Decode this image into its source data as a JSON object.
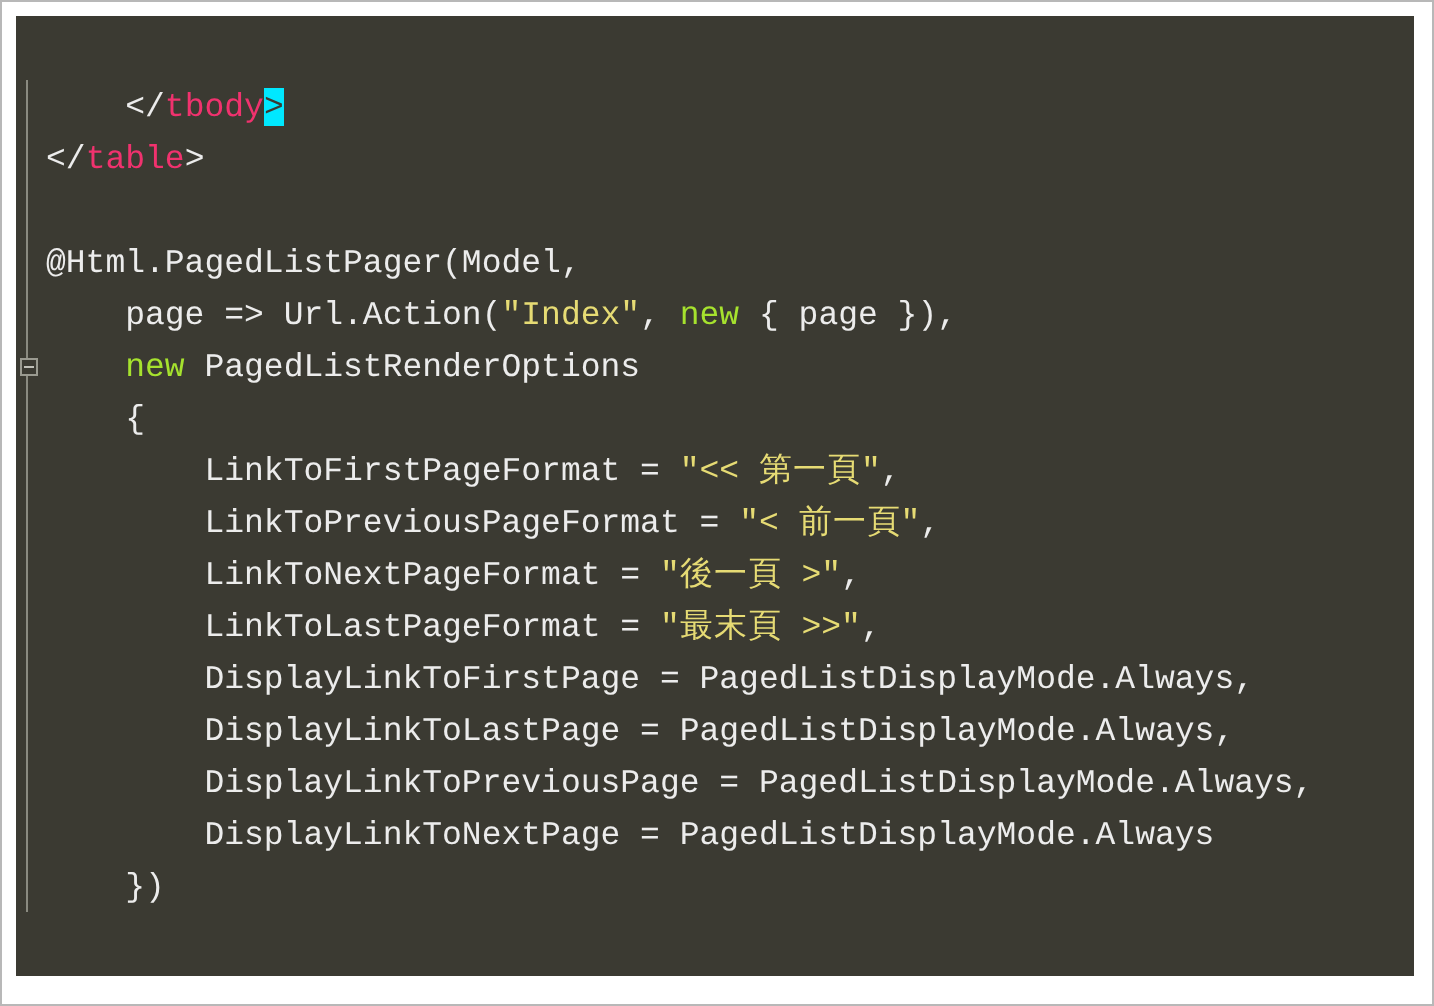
{
  "editor": {
    "lines": [
      {
        "kind": "code",
        "foldable": false,
        "tokens": [
          {
            "kind": "plain",
            "text": "    </"
          },
          {
            "kind": "tag",
            "text": "tbody"
          },
          {
            "kind": "match",
            "text": ">"
          }
        ]
      },
      {
        "kind": "code",
        "foldable": false,
        "tokens": [
          {
            "kind": "plain",
            "text": "</"
          },
          {
            "kind": "tag",
            "text": "table"
          },
          {
            "kind": "plain",
            "text": ">"
          }
        ]
      },
      {
        "kind": "blank",
        "foldable": false
      },
      {
        "kind": "code",
        "foldable": false,
        "tokens": [
          {
            "kind": "plain",
            "text": "@Html.PagedListPager(Model,"
          }
        ]
      },
      {
        "kind": "code",
        "foldable": false,
        "tokens": [
          {
            "kind": "plain",
            "text": "    page => Url.Action("
          },
          {
            "kind": "string",
            "text": "\"Index\""
          },
          {
            "kind": "plain",
            "text": ", "
          },
          {
            "kind": "keyword",
            "text": "new"
          },
          {
            "kind": "plain",
            "text": " { page }),"
          }
        ]
      },
      {
        "kind": "code",
        "foldable": true,
        "tokens": [
          {
            "kind": "keyword",
            "text": "    new"
          },
          {
            "kind": "plain",
            "text": " PagedListRenderOptions"
          }
        ]
      },
      {
        "kind": "code",
        "foldable": false,
        "tokens": [
          {
            "kind": "plain",
            "text": "    {"
          }
        ]
      },
      {
        "kind": "code",
        "foldable": false,
        "tokens": [
          {
            "kind": "plain",
            "text": "        LinkToFirstPageFormat = "
          },
          {
            "kind": "string",
            "text": "\"<< 第一頁\""
          },
          {
            "kind": "plain",
            "text": ","
          }
        ]
      },
      {
        "kind": "code",
        "foldable": false,
        "tokens": [
          {
            "kind": "plain",
            "text": "        LinkToPreviousPageFormat = "
          },
          {
            "kind": "string",
            "text": "\"< 前一頁\""
          },
          {
            "kind": "plain",
            "text": ","
          }
        ]
      },
      {
        "kind": "code",
        "foldable": false,
        "tokens": [
          {
            "kind": "plain",
            "text": "        LinkToNextPageFormat = "
          },
          {
            "kind": "string",
            "text": "\"後一頁 >\""
          },
          {
            "kind": "plain",
            "text": ","
          }
        ]
      },
      {
        "kind": "code",
        "foldable": false,
        "tokens": [
          {
            "kind": "plain",
            "text": "        LinkToLastPageFormat = "
          },
          {
            "kind": "string",
            "text": "\"最末頁 >>\""
          },
          {
            "kind": "plain",
            "text": ","
          }
        ]
      },
      {
        "kind": "code",
        "foldable": false,
        "tokens": [
          {
            "kind": "plain",
            "text": "        DisplayLinkToFirstPage = PagedListDisplayMode.Always,"
          }
        ]
      },
      {
        "kind": "code",
        "foldable": false,
        "tokens": [
          {
            "kind": "plain",
            "text": "        DisplayLinkToLastPage = PagedListDisplayMode.Always,"
          }
        ]
      },
      {
        "kind": "code",
        "foldable": false,
        "tokens": [
          {
            "kind": "plain",
            "text": "        DisplayLinkToPreviousPage = PagedListDisplayMode.Always,"
          }
        ]
      },
      {
        "kind": "code",
        "foldable": false,
        "tokens": [
          {
            "kind": "plain",
            "text": "        DisplayLinkToNextPage = PagedListDisplayMode.Always"
          }
        ]
      },
      {
        "kind": "code",
        "foldable": false,
        "tokens": [
          {
            "kind": "plain",
            "text": "    })"
          }
        ]
      }
    ]
  }
}
